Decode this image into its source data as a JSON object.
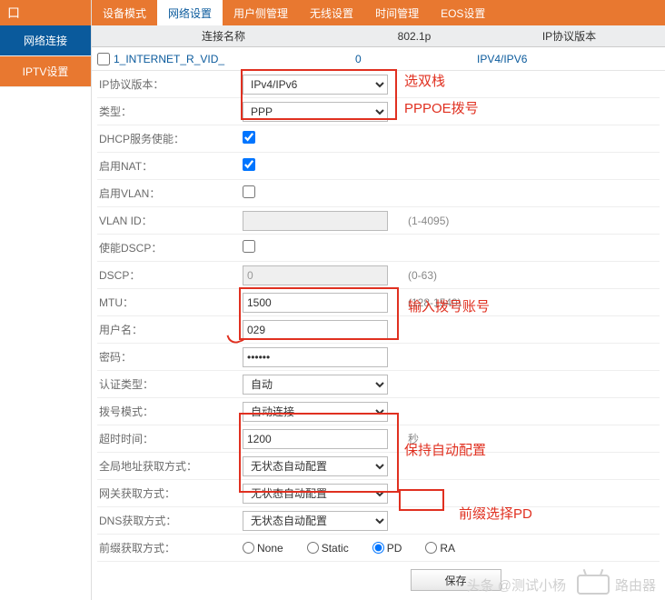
{
  "logo_fragment": "口",
  "sidebar": {
    "items": [
      {
        "label": "网络连接"
      },
      {
        "label": "IPTV设置"
      }
    ]
  },
  "tabs": [
    {
      "label": "设备模式"
    },
    {
      "label": "网络设置"
    },
    {
      "label": "用户侧管理"
    },
    {
      "label": "无线设置"
    },
    {
      "label": "时间管理"
    },
    {
      "label": "EOS设置"
    }
  ],
  "header": {
    "c1": "连接名称",
    "c2": "802.1p",
    "c3": "IP协议版本"
  },
  "row0": {
    "name": "1_INTERNET_R_VID_",
    "p": "0",
    "ipver": "IPV4/IPV6"
  },
  "form": {
    "ipver_label": "IP协议版本：",
    "ipver_value": "IPv4/IPv6",
    "type_label": "类型：",
    "type_value": "PPP",
    "dhcp_label": "DHCP服务使能：",
    "nat_label": "启用NAT：",
    "vlan_en_label": "启用VLAN：",
    "vlanid_label": "VLAN ID：",
    "vlanid_hint": "(1-4095)",
    "dscp_en_label": "使能DSCP：",
    "dscp_label": "DSCP：",
    "dscp_value": "0",
    "dscp_hint": "(0-63)",
    "mtu_label": "MTU：",
    "mtu_value": "1500",
    "mtu_hint": "(128-1540)",
    "user_label": "用户名：",
    "user_value": "029",
    "pass_label": "密码：",
    "pass_value": "••••••",
    "auth_label": "认证类型：",
    "auth_value": "自动",
    "dial_label": "拨号模式：",
    "dial_value": "自动连接",
    "timeout_label": "超时时间：",
    "timeout_value": "1200",
    "timeout_unit": "秒",
    "gaddr_label": "全局地址获取方式：",
    "gaddr_value": "无状态自动配置",
    "gw_label": "网关获取方式：",
    "gw_value": "无状态自动配置",
    "dns_label": "DNS获取方式：",
    "dns_value": "无状态自动配置",
    "prefix_label": "前缀获取方式：",
    "radio": {
      "none": "None",
      "static": "Static",
      "pd": "PD",
      "ra": "RA"
    },
    "save": "保存"
  },
  "annotations": {
    "a1": "选双栈",
    "a2": "PPPOE拨号",
    "a3": "输入拨号账号",
    "a4": "保持自动配置",
    "a5": "前缀选择PD"
  },
  "watermark": {
    "text": "头条 @测试小杨",
    "router": "路由器"
  }
}
